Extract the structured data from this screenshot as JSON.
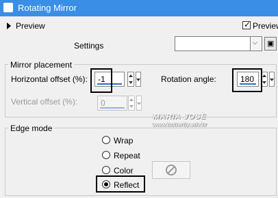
{
  "window": {
    "title": "Rotating Mirror",
    "icon": "camera-icon"
  },
  "preview": {
    "label": "Preview",
    "checkbox_label": "Preview",
    "checked": true
  },
  "settings": {
    "label": "Settings",
    "value": ""
  },
  "mirror_placement": {
    "group_label": "Mirror placement",
    "horizontal_offset": {
      "label": "Horizontal offset (%):",
      "value": "-1"
    },
    "rotation_angle": {
      "label": "Rotation angle:",
      "value": "180"
    },
    "vertical_offset": {
      "label": "Vertical offset (%):",
      "value": "0",
      "enabled": false
    }
  },
  "edge_mode": {
    "group_label": "Edge mode",
    "options": [
      {
        "label": "Wrap",
        "selected": false
      },
      {
        "label": "Repeat",
        "selected": false
      },
      {
        "label": "Color",
        "selected": false
      },
      {
        "label": "Reflect",
        "selected": true
      }
    ],
    "color_swatch_icon": "no-entry-icon"
  },
  "watermark": {
    "name": "MARIA JOSÈ",
    "url": "www.butterfly.adv.br"
  },
  "colors": {
    "titlebar": "#3a8ee6",
    "accent": "#2b6cc4",
    "background": "#f0f0f0"
  }
}
